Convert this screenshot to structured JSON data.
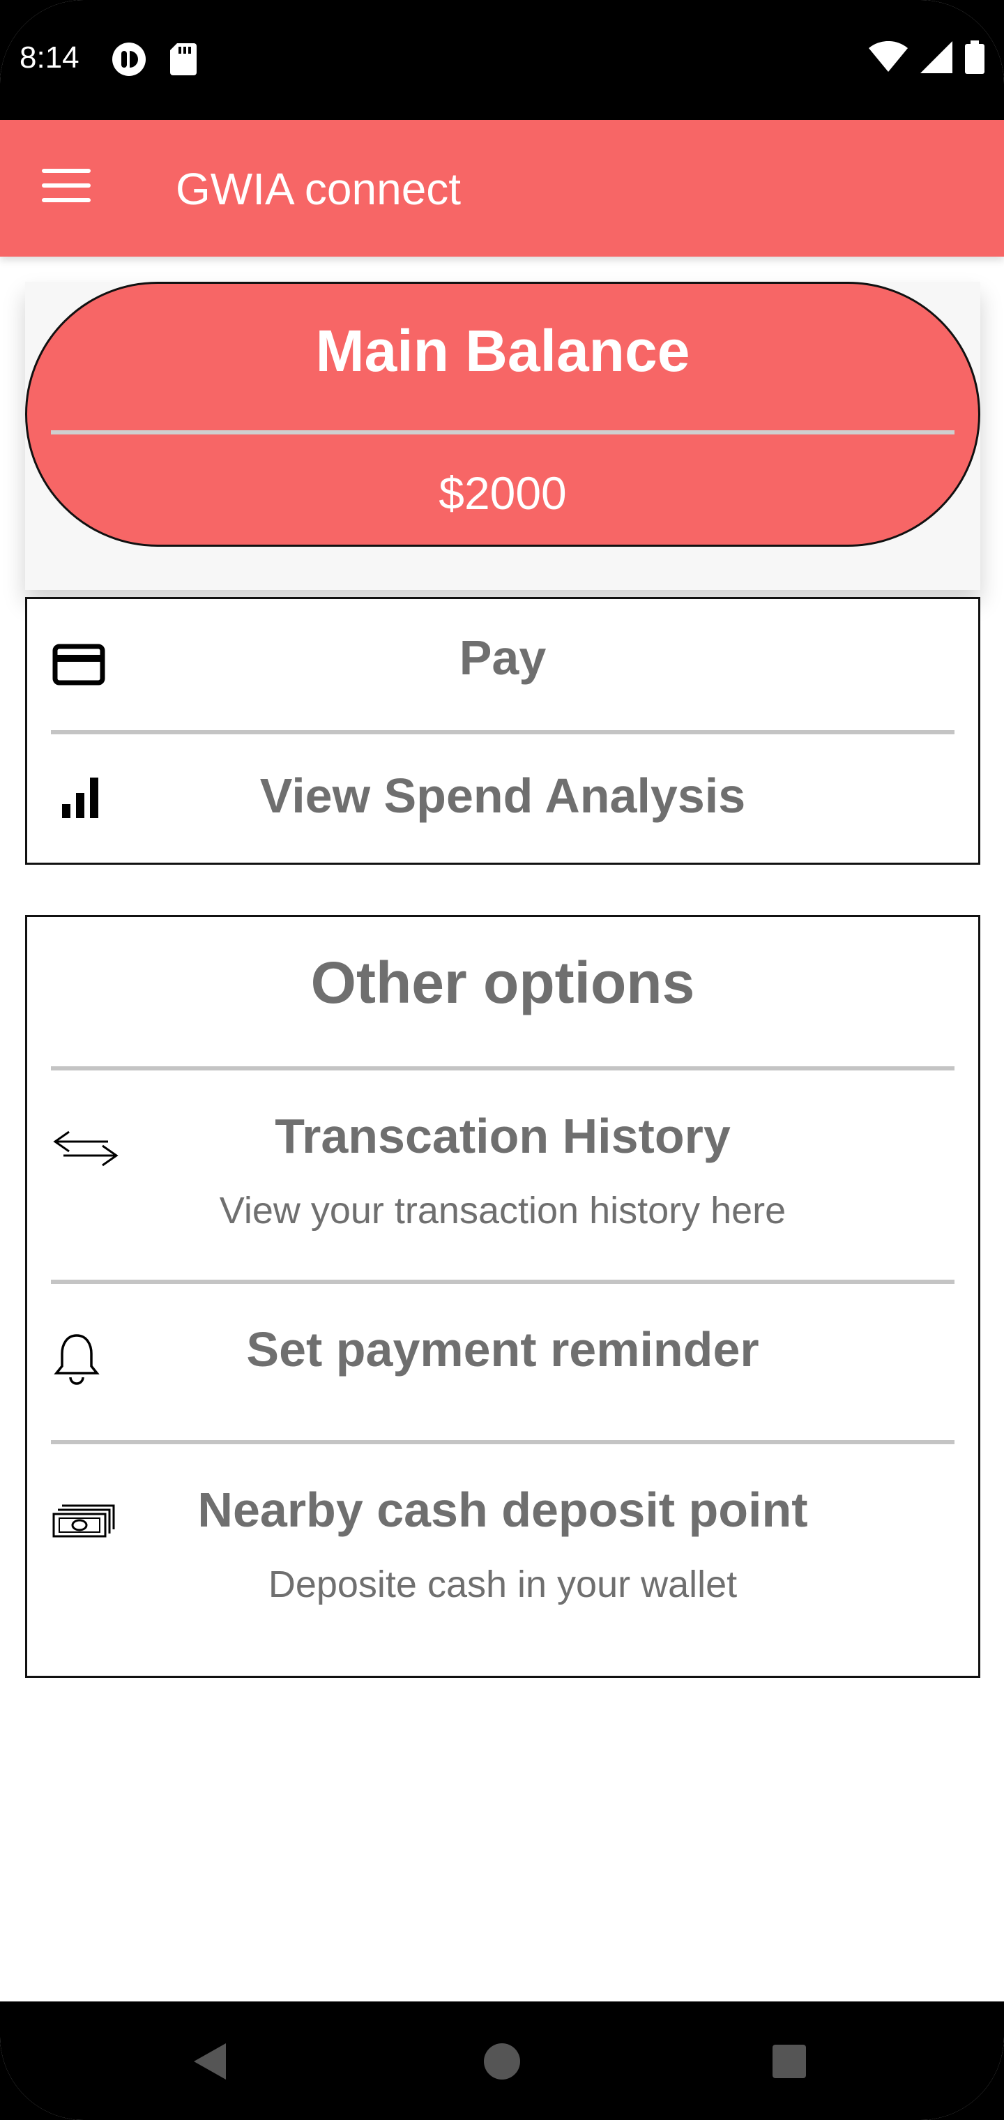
{
  "status_bar": {
    "time": "8:14"
  },
  "app_bar": {
    "title": "GWIA connect",
    "menu_icon": "hamburger-menu-icon"
  },
  "balance": {
    "title": "Main Balance",
    "value": "$2000"
  },
  "actions": [
    {
      "label": "Pay",
      "icon": "credit-card-icon"
    },
    {
      "label": "View Spend Analysis",
      "icon": "bar-chart-icon"
    }
  ],
  "other_options": {
    "title": "Other options",
    "items": [
      {
        "label": "Transcation History",
        "subtitle": "View your transaction history here",
        "icon": "swap-arrows-icon"
      },
      {
        "label": "Set payment reminder",
        "icon": "bell-icon"
      },
      {
        "label": "Nearby cash deposit point",
        "subtitle": "Deposite cash in your wallet",
        "icon": "cash-icon"
      }
    ]
  },
  "colors": {
    "accent": "#f76666",
    "text_gray": "#6f6f6f",
    "divider": "#c4c4c4"
  },
  "nav_bar": {
    "back_icon": "back-triangle-icon",
    "home_icon": "home-circle-icon",
    "recents_icon": "recents-square-icon"
  }
}
